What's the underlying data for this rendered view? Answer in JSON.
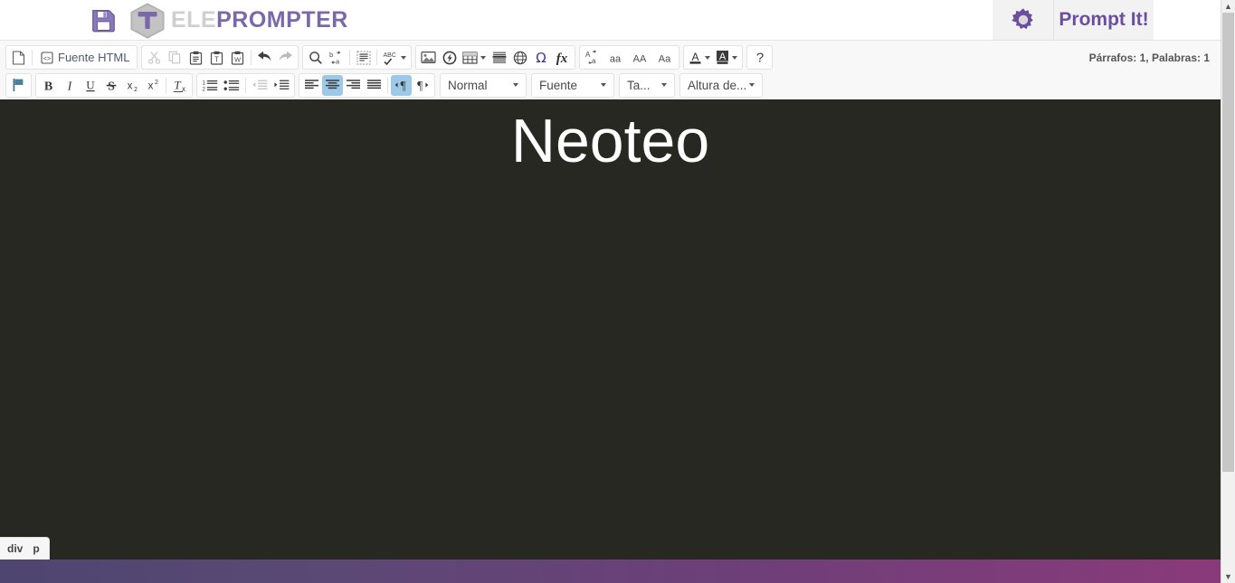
{
  "header": {
    "save_icon": "floppy-disk-save-icon",
    "brand_mark": "teleprompter-hex-t-logo",
    "brand_text_light": "ELE",
    "brand_text_accent": "PROMPTER",
    "gear_icon": "gear-icon",
    "prompt_button": "Prompt It!",
    "accent_color": "#6b4f9e",
    "brand_light_color": "#cfcfcf"
  },
  "toolbar": {
    "row1": [
      {
        "group": "document",
        "buttons": [
          {
            "name": "new-page-button",
            "icon": "new-page-icon",
            "label": "",
            "state": "normal"
          },
          {
            "name": "separator",
            "icon": "separator",
            "label": "",
            "state": "sep"
          },
          {
            "name": "html-source-button",
            "icon": "source-code-icon",
            "label": "Fuente HTML",
            "state": "normal"
          }
        ]
      },
      {
        "group": "clipboard",
        "buttons": [
          {
            "name": "cut-button",
            "icon": "scissors-icon",
            "label": "",
            "state": "disabled"
          },
          {
            "name": "copy-button",
            "icon": "copy-icon",
            "label": "",
            "state": "disabled"
          },
          {
            "name": "paste-button",
            "icon": "paste-icon",
            "label": "",
            "state": "normal"
          },
          {
            "name": "paste-as-plain-text-button",
            "icon": "paste-text-icon",
            "label": "",
            "state": "normal"
          },
          {
            "name": "paste-from-word-button",
            "icon": "paste-word-icon",
            "label": "",
            "state": "normal"
          },
          {
            "name": "separator",
            "icon": "separator",
            "label": "",
            "state": "sep"
          },
          {
            "name": "undo-button",
            "icon": "undo-arrow-icon",
            "label": "",
            "state": "normal"
          },
          {
            "name": "redo-button",
            "icon": "redo-arrow-icon",
            "label": "",
            "state": "disabled"
          }
        ]
      },
      {
        "group": "editing",
        "buttons": [
          {
            "name": "find-button",
            "icon": "magnifier-icon",
            "label": "",
            "state": "normal"
          },
          {
            "name": "replace-button",
            "icon": "replace-ba-icon",
            "label": "",
            "state": "normal"
          },
          {
            "name": "separator",
            "icon": "separator",
            "label": "",
            "state": "sep"
          },
          {
            "name": "select-all-button",
            "icon": "select-all-icon",
            "label": "",
            "state": "normal"
          },
          {
            "name": "separator",
            "icon": "separator",
            "label": "",
            "state": "sep"
          },
          {
            "name": "spellcheck-button",
            "icon": "abc-spellcheck-icon",
            "label": "",
            "state": "menu"
          }
        ]
      },
      {
        "group": "insert",
        "buttons": [
          {
            "name": "insert-image-button",
            "icon": "image-icon",
            "label": "",
            "state": "normal"
          },
          {
            "name": "insert-flash-button",
            "icon": "flash-icon",
            "label": "",
            "state": "normal"
          },
          {
            "name": "insert-table-button",
            "icon": "table-icon",
            "label": "",
            "state": "menu"
          },
          {
            "name": "horizontal-rule-button",
            "icon": "horizontal-rule-icon",
            "label": "",
            "state": "normal"
          },
          {
            "name": "insert-iframe-button",
            "icon": "globe-iframe-icon",
            "label": "",
            "state": "normal"
          },
          {
            "name": "special-character-button",
            "icon": "omega-icon",
            "label": "",
            "state": "normal"
          },
          {
            "name": "math-formula-button",
            "icon": "fx-icon",
            "label": "",
            "state": "normal"
          }
        ]
      },
      {
        "group": "case",
        "buttons": [
          {
            "name": "change-case-button",
            "icon": "case-swap-icon",
            "label": "",
            "state": "normal"
          },
          {
            "name": "lowercase-button",
            "icon": "lowercase-aa-icon",
            "label": "",
            "state": "normal"
          },
          {
            "name": "uppercase-button",
            "icon": "uppercase-AA-icon",
            "label": "",
            "state": "normal"
          },
          {
            "name": "capitalize-button",
            "icon": "capitalize-Aa-icon",
            "label": "",
            "state": "normal"
          }
        ]
      },
      {
        "group": "colors",
        "buttons": [
          {
            "name": "text-color-button",
            "icon": "text-color-icon",
            "label": "",
            "state": "menu"
          },
          {
            "name": "background-color-button",
            "icon": "background-color-icon",
            "label": "",
            "state": "menu"
          }
        ]
      },
      {
        "group": "help",
        "buttons": [
          {
            "name": "help-button",
            "icon": "question-mark-icon",
            "label": "",
            "state": "normal"
          }
        ]
      }
    ],
    "row2": [
      {
        "group": "flag",
        "buttons": [
          {
            "name": "language-flag-button",
            "icon": "flag-icon",
            "label": "",
            "state": "normal"
          }
        ]
      },
      {
        "group": "basicstyles",
        "buttons": [
          {
            "name": "bold-button",
            "icon": "bold-B-icon",
            "label": "",
            "state": "normal"
          },
          {
            "name": "italic-button",
            "icon": "italic-I-icon",
            "label": "",
            "state": "normal"
          },
          {
            "name": "underline-button",
            "icon": "underline-U-icon",
            "label": "",
            "state": "normal"
          },
          {
            "name": "strikethrough-button",
            "icon": "strikethrough-S-icon",
            "label": "",
            "state": "normal"
          },
          {
            "name": "subscript-button",
            "icon": "subscript-icon",
            "label": "",
            "state": "normal"
          },
          {
            "name": "superscript-button",
            "icon": "superscript-icon",
            "label": "",
            "state": "normal"
          },
          {
            "name": "separator",
            "icon": "separator",
            "label": "",
            "state": "sep"
          },
          {
            "name": "remove-format-button",
            "icon": "remove-format-Tx-icon",
            "label": "",
            "state": "normal"
          }
        ]
      },
      {
        "group": "lists",
        "buttons": [
          {
            "name": "numbered-list-button",
            "icon": "numbered-list-icon",
            "label": "",
            "state": "normal"
          },
          {
            "name": "bulleted-list-button",
            "icon": "bulleted-list-icon",
            "label": "",
            "state": "normal"
          },
          {
            "name": "separator",
            "icon": "separator",
            "label": "",
            "state": "sep"
          },
          {
            "name": "outdent-button",
            "icon": "outdent-icon",
            "label": "",
            "state": "disabled"
          },
          {
            "name": "indent-button",
            "icon": "indent-icon",
            "label": "",
            "state": "normal"
          }
        ]
      },
      {
        "group": "paragraph",
        "buttons": [
          {
            "name": "align-left-button",
            "icon": "align-left-icon",
            "label": "",
            "state": "normal"
          },
          {
            "name": "align-center-button",
            "icon": "align-center-icon",
            "label": "",
            "state": "active"
          },
          {
            "name": "align-right-button",
            "icon": "align-right-icon",
            "label": "",
            "state": "normal"
          },
          {
            "name": "align-justify-button",
            "icon": "align-justify-icon",
            "label": "",
            "state": "normal"
          },
          {
            "name": "separator",
            "icon": "separator",
            "label": "",
            "state": "sep"
          },
          {
            "name": "text-direction-ltr-button",
            "icon": "direction-ltr-icon",
            "label": "",
            "state": "active"
          },
          {
            "name": "text-direction-rtl-button",
            "icon": "direction-rtl-icon",
            "label": "",
            "state": "normal"
          }
        ]
      }
    ],
    "combos": {
      "paragraph_format": "Normal",
      "font_family": "Fuente",
      "font_size": "Ta...",
      "line_height": "Altura de..."
    },
    "counter": "Párrafos: 1, Palabras: 1"
  },
  "content": {
    "text": "Neoteo",
    "background_color": "#282823",
    "text_color": "#ffffff",
    "elements_path": [
      "div",
      "p"
    ]
  },
  "footer": {
    "gradient_from": "#4d4670",
    "gradient_to": "#8a3a7a"
  },
  "scrollbar": {
    "up_arrow": "chevron-up-icon",
    "down_arrow": "chevron-down-icon"
  }
}
